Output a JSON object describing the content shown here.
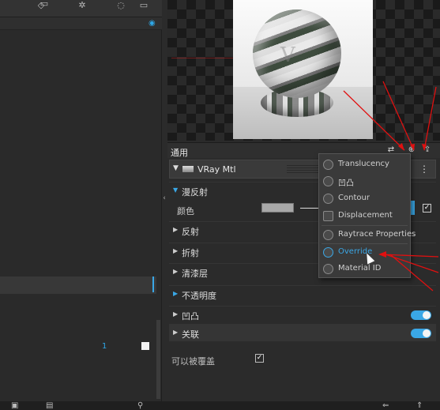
{
  "left_panel": {
    "toolbar_icons": [
      "cube-icon",
      "save-icon",
      "gear-icon",
      "help-icon",
      "frame-icon"
    ],
    "selected_number": "1"
  },
  "header": {
    "tab_label": "通用",
    "icons": [
      "sliders-icon",
      "add-icon",
      "share-icon"
    ]
  },
  "material": {
    "name": "VRay Mtl"
  },
  "sections": [
    {
      "label": "漫反射",
      "open": true
    },
    {
      "label": "反射",
      "open": false
    },
    {
      "label": "折射",
      "open": false
    },
    {
      "label": "清漆层",
      "open": false
    },
    {
      "label": "不透明度",
      "open": true
    },
    {
      "label": "凹凸",
      "open": false,
      "toggle": true
    },
    {
      "label": "关联",
      "open": false,
      "toggle": true
    }
  ],
  "diffuse": {
    "color_label": "颜色",
    "color_value": "#a8a8a8"
  },
  "can_override_label": "可以被覆盖",
  "dropdown": {
    "items": [
      {
        "label": "Translucency",
        "active": false
      },
      {
        "label": "凹凸",
        "active": false
      },
      {
        "label": "Contour",
        "active": false
      },
      {
        "label": "Displacement",
        "active": false
      },
      {
        "label": "Raytrace Properties",
        "active": false
      },
      {
        "label": "Override",
        "active": true
      },
      {
        "label": "Material ID",
        "active": false
      }
    ]
  },
  "colors": {
    "accent": "#3aa7e6",
    "annotation": "#e01010",
    "panel_bg": "#2b2b2b"
  }
}
